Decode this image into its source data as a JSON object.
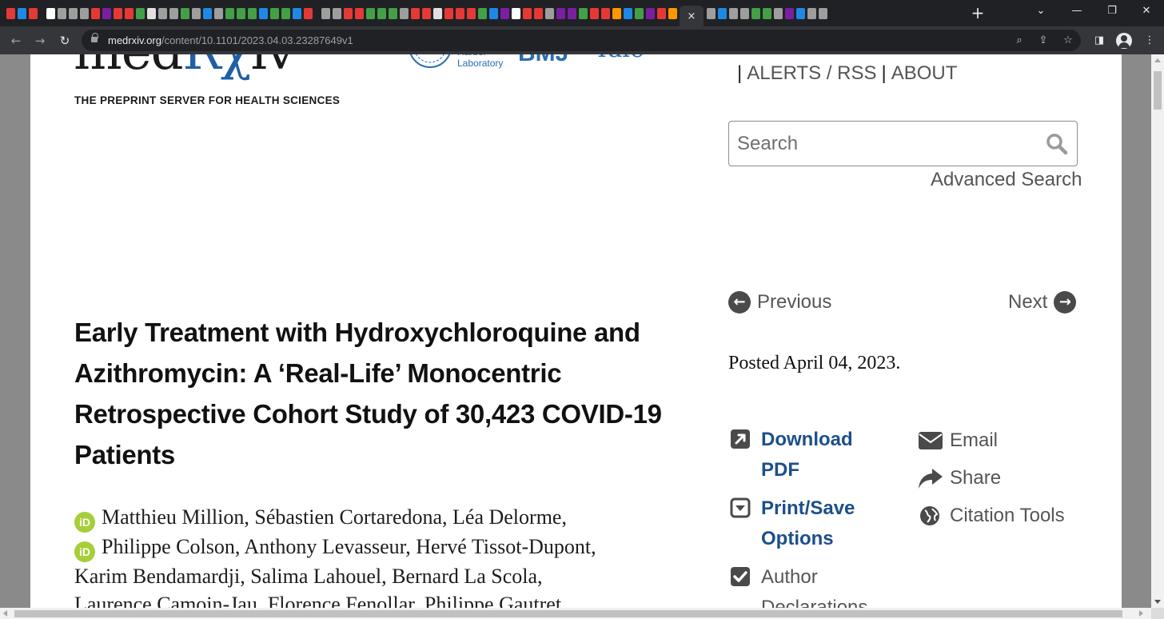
{
  "browser": {
    "url_host": "medrxiv.org",
    "url_path": "/content/10.1101/2023.04.03.23287649v1",
    "active_tab_close": "×",
    "new_tab": "+",
    "tab_favicon_colors": [
      "#e53935",
      "#1e88e5",
      "#e53935",
      "#ffffff",
      "#9e9e9e",
      "#9e9e9e",
      "#9e9e9e",
      "#e53935",
      "#7b1fa2",
      "#e53935",
      "#e53935",
      "#43a047",
      "#e0e0e0",
      "#9e9e9e",
      "#9e9e9e",
      "#43a047",
      "#9e9e9e",
      "#1e88e5",
      "#9e9e9e",
      "#43a047",
      "#43a047",
      "#43a047",
      "#1e88e5",
      "#43a047",
      "#43a047",
      "#1e88e5",
      "#e53935",
      "#9e9e9e",
      "#9e9e9e",
      "#e53935",
      "#e53935",
      "#43a047",
      "#43a047",
      "#43a047",
      "#9e9e9e",
      "#e53935",
      "#e53935",
      "#e0e0e0",
      "#e53935",
      "#e53935",
      "#e53935",
      "#43a047",
      "#1e88e5",
      "#7b1fa2",
      "#ffffff",
      "#e53935",
      "#e53935",
      "#9e9e9e",
      "#7b1fa2",
      "#7b1fa2",
      "#43a047",
      "#e53935",
      "#e53935",
      "#ff9800",
      "#1e88e5",
      "#43a047",
      "#7b1fa2",
      "#e53935",
      "#ff9800"
    ],
    "tab_favicon_colors_right": [
      "#9e9e9e",
      "#1e88e5",
      "#9e9e9e",
      "#9e9e9e",
      "#43a047",
      "#43a047",
      "#9e9e9e",
      "#7b1fa2",
      "#1e88e5",
      "#9e9e9e",
      "#9e9e9e"
    ]
  },
  "site": {
    "logo_prefix": "med",
    "logo_rx": "Rχ",
    "logo_suffix": "iv",
    "tagline": "THE PREPRINT SERVER FOR HEALTH SCIENCES",
    "partner_csh": "Harbor\nLaboratory",
    "partner_bmj": "BMJ",
    "partner_yale": "Yale",
    "nav_alerts": "ALERTS / RSS",
    "nav_about": "ABOUT",
    "nav_sep": "|",
    "search_placeholder": "Search",
    "advanced_search": "Advanced Search"
  },
  "sidebar": {
    "previous": "Previous",
    "next": "Next",
    "posted": "Posted April 04, 2023.",
    "download_pdf": "Download PDF",
    "print_save": "Print/Save Options",
    "author_decl": "Author Declarations",
    "email": "Email",
    "share": "Share",
    "citation_tools": "Citation Tools"
  },
  "article": {
    "title": "Early Treatment with Hydroxychloroquine and Azithromycin: A ‘Real-Life’ Monocentric Retrospective Cohort Study of 30,423 COVID-19 Patients",
    "orcid_label": "iD",
    "authors_line1": "Matthieu Million, Sébastien Cortaredona, Léa Delorme,",
    "authors_line2": "Philippe Colson, Anthony Levasseur, Hervé Tissot-Dupont,",
    "authors_line3": "Karim Bendamardji, Salima Lahouel, Bernard La Scola,",
    "authors_line4": "Laurence Camoin-Jau, Florence Fenollar, Philippe Gautret,"
  },
  "colors": {
    "link_blue": "#1c4f8a",
    "logo_blue": "#1f5ea8",
    "orcid_green": "#a6ce39"
  }
}
